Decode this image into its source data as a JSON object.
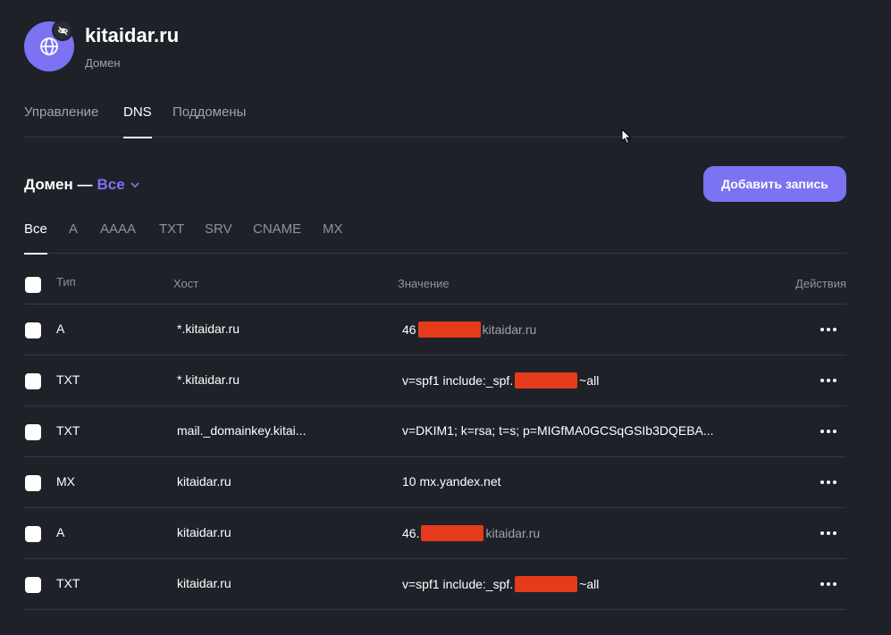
{
  "header": {
    "domain": "kitaidar.ru",
    "subtitle": "Домен",
    "avatar_icon": "globe-icon",
    "badge_icon": "eye-off-icon"
  },
  "tabs": [
    {
      "label": "Управление",
      "active": false
    },
    {
      "label": "DNS",
      "active": true
    },
    {
      "label": "Поддомены",
      "active": false
    }
  ],
  "section": {
    "title": "Домен —",
    "filter_value": "Все",
    "add_button": "Добавить запись"
  },
  "type_filters": [
    {
      "label": "Все",
      "active": true
    },
    {
      "label": "A",
      "active": false
    },
    {
      "label": "AAAA",
      "active": false
    },
    {
      "label": "TXT",
      "active": false
    },
    {
      "label": "SRV",
      "active": false
    },
    {
      "label": "CNAME",
      "active": false
    },
    {
      "label": "MX",
      "active": false
    }
  ],
  "table": {
    "columns": {
      "type": "Тип",
      "host": "Хост",
      "value": "Значение",
      "actions": "Действия"
    },
    "rows": [
      {
        "type": "A",
        "host": "*.kitaidar.ru",
        "value_prefix": "46",
        "value_suffix": "kitaidar.ru",
        "redacted": true,
        "suffix_dim": true
      },
      {
        "type": "TXT",
        "host": "*.kitaidar.ru",
        "value_prefix": "v=spf1 include:_spf.",
        "value_suffix": "~all",
        "redacted": true,
        "suffix_dim": false
      },
      {
        "type": "TXT",
        "host": "mail._domainkey.kitai...",
        "value_prefix": "v=DKIM1; k=rsa; t=s; p=MIGfMA0GCSqGSIb3DQEBA...",
        "value_suffix": "",
        "redacted": false,
        "suffix_dim": false
      },
      {
        "type": "MX",
        "host": "kitaidar.ru",
        "value_prefix": "10 mx.yandex.net",
        "value_suffix": "",
        "redacted": false,
        "suffix_dim": false
      },
      {
        "type": "A",
        "host": "kitaidar.ru",
        "value_prefix": "46.",
        "value_suffix": "kitaidar.ru",
        "redacted": true,
        "suffix_dim": true
      },
      {
        "type": "TXT",
        "host": "kitaidar.ru",
        "value_prefix": "v=spf1 include:_spf.",
        "value_suffix": "~all",
        "redacted": true,
        "suffix_dim": false
      }
    ]
  },
  "colors": {
    "background": "#1f2129",
    "accent": "#7b73f2",
    "redaction": "#e63a1c"
  }
}
